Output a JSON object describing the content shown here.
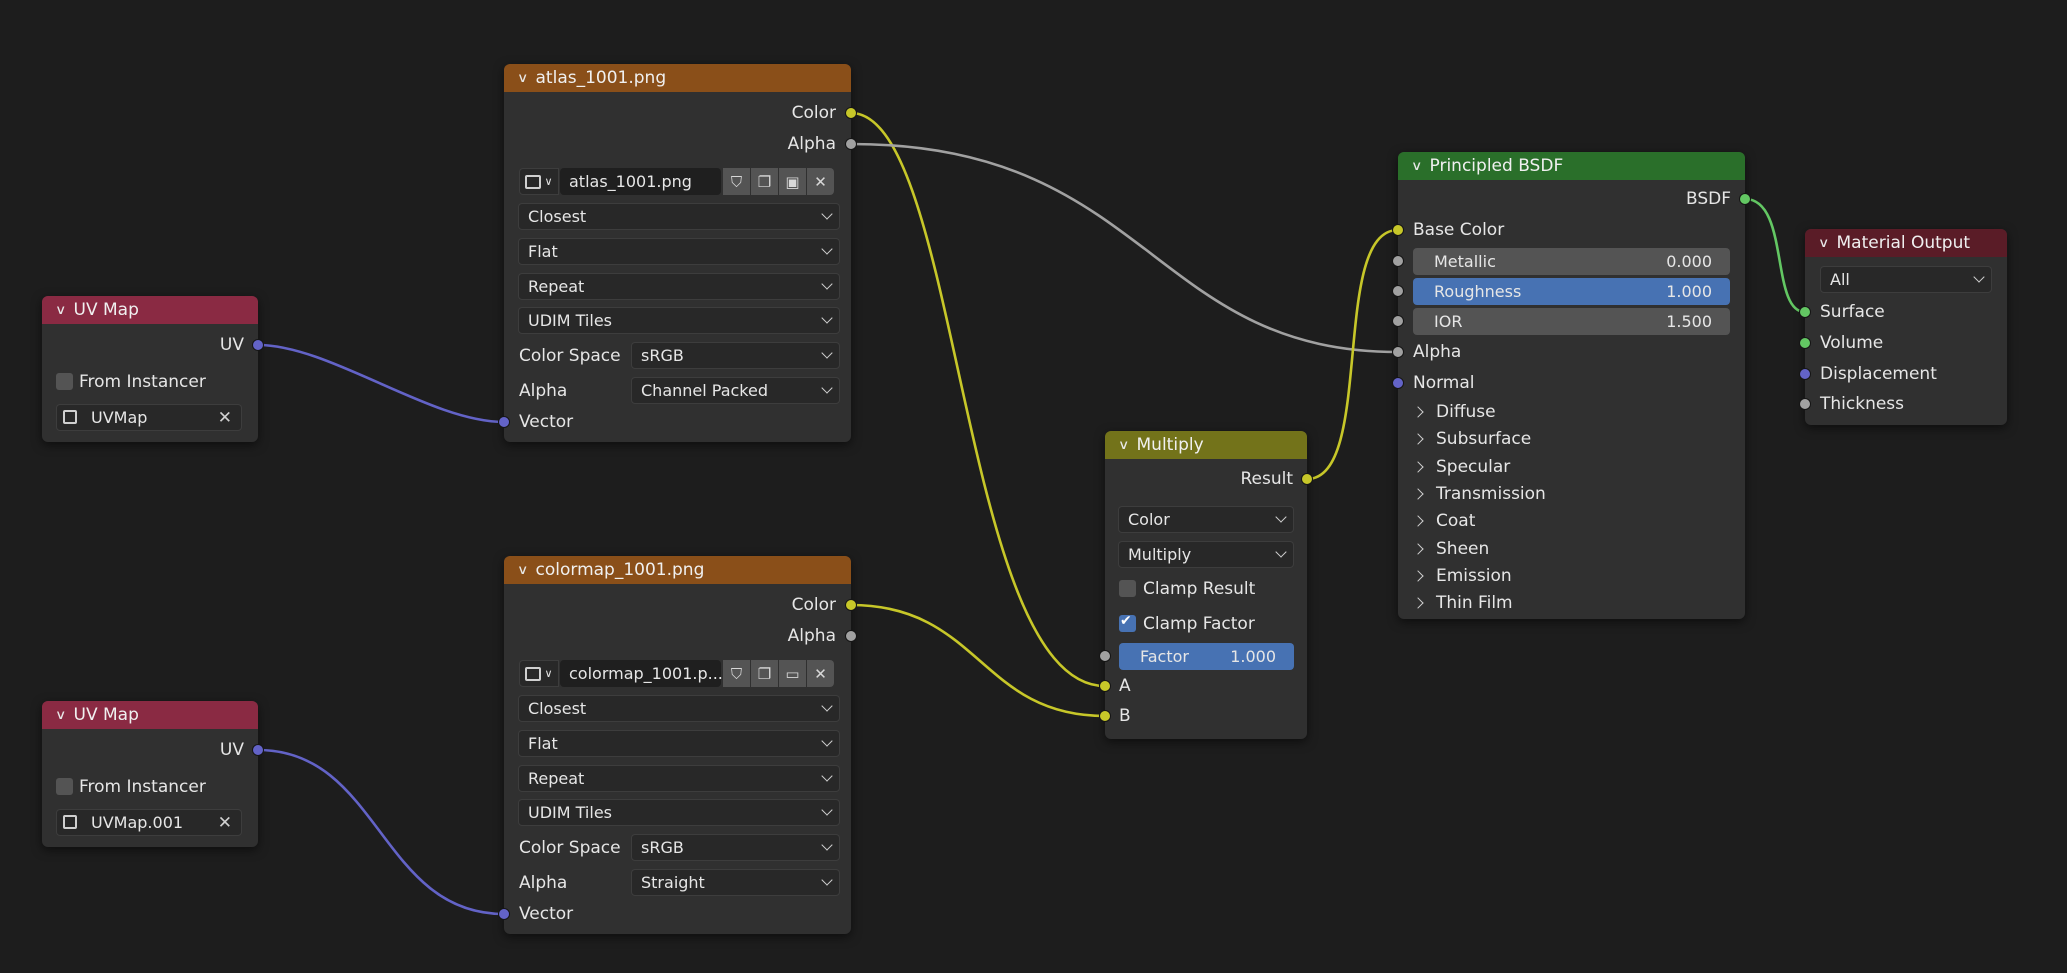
{
  "colors": {
    "background": "#1d1d1d",
    "node_body": "#303030",
    "header_texture": "#8a4f19",
    "header_input": "#8a2a43",
    "header_converter": "#73731a",
    "header_shader": "#2a6f2a",
    "header_output": "#5a1c27",
    "socket_color": "#c7c729",
    "socket_float": "#a1a1a1",
    "socket_vector": "#6363c7",
    "socket_shader": "#63c763",
    "slider_active": "#4772b3"
  },
  "uv_map_1": {
    "title": "UV Map",
    "output_uv": "UV",
    "from_instancer": "From Instancer",
    "uvmap_value": "UVMap",
    "node_icon": "uv-node-icon",
    "clear_icon": "x-icon"
  },
  "uv_map_2": {
    "title": "UV Map",
    "output_uv": "UV",
    "from_instancer": "From Instancer",
    "uvmap_value": "UVMap.001",
    "node_icon": "uv-node-icon",
    "clear_icon": "x-icon"
  },
  "image_1": {
    "title": "atlas_1001.png",
    "out_color": "Color",
    "out_alpha": "Alpha",
    "image_name": "atlas_1001.png",
    "interpolation": "Closest",
    "projection": "Flat",
    "extension": "Repeat",
    "source": "UDIM Tiles",
    "color_space_label": "Color Space",
    "color_space": "sRGB",
    "alpha_label": "Alpha",
    "alpha_mode": "Channel Packed",
    "in_vector": "Vector"
  },
  "image_2": {
    "title": "colormap_1001.png",
    "out_color": "Color",
    "out_alpha": "Alpha",
    "image_name": "colormap_1001.p...",
    "interpolation": "Closest",
    "projection": "Flat",
    "extension": "Repeat",
    "source": "UDIM Tiles",
    "color_space_label": "Color Space",
    "color_space": "sRGB",
    "alpha_label": "Alpha",
    "alpha_mode": "Straight",
    "in_vector": "Vector"
  },
  "multiply": {
    "title": "Multiply",
    "out_result": "Result",
    "data_type": "Color",
    "blend_mode": "Multiply",
    "clamp_result": "Clamp Result",
    "clamp_factor": "Clamp Factor",
    "factor_label": "Factor",
    "factor_value": "1.000",
    "in_a": "A",
    "in_b": "B"
  },
  "bsdf": {
    "title": "Principled BSDF",
    "out_bsdf": "BSDF",
    "base_color": "Base Color",
    "metallic_label": "Metallic",
    "metallic_value": "0.000",
    "metallic_fill": 0,
    "roughness_label": "Roughness",
    "roughness_value": "1.000",
    "roughness_fill": 1,
    "ior_label": "IOR",
    "ior_value": "1.500",
    "alpha": "Alpha",
    "normal": "Normal",
    "panels": [
      "Diffuse",
      "Subsurface",
      "Specular",
      "Transmission",
      "Coat",
      "Sheen",
      "Emission",
      "Thin Film"
    ]
  },
  "output": {
    "title": "Material Output",
    "target": "All",
    "in_surface": "Surface",
    "in_volume": "Volume",
    "in_displacement": "Displacement",
    "in_thickness": "Thickness"
  }
}
